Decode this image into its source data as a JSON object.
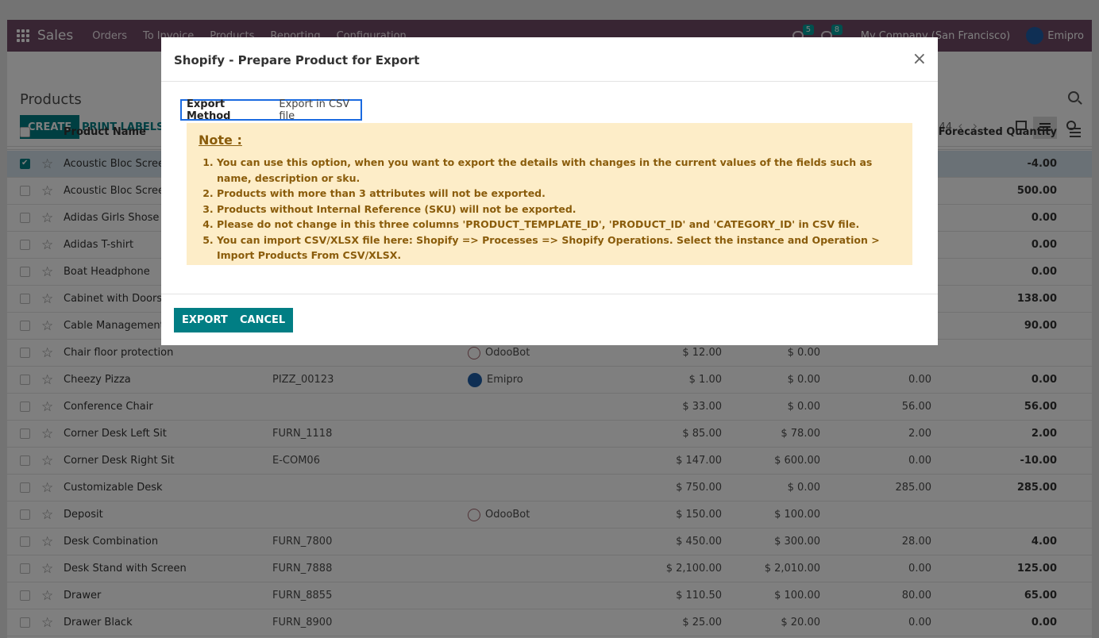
{
  "navbar": {
    "app_name": "Sales",
    "menu": [
      "Orders",
      "To Invoice",
      "Products",
      "Reporting",
      "Configuration"
    ],
    "messages_count": "5",
    "activities_count": "8",
    "company": "My Company (San Francisco)",
    "user": "Emipro"
  },
  "control_panel": {
    "title": "Products",
    "create_label": "CREATE",
    "print_labels_label": "PRINT LABELS",
    "pager_text": "44"
  },
  "table": {
    "col_product_name": "Product Name",
    "col_forecasted": "Forecasted Quantity",
    "rows": [
      {
        "name": "Acoustic Bloc Screens",
        "ref": "",
        "responsible": "",
        "price": "",
        "cost": "",
        "onhand": "",
        "forecast": "-4.00"
      },
      {
        "name": "Acoustic Bloc Screens",
        "ref": "",
        "responsible": "",
        "price": "",
        "cost": "",
        "onhand": "",
        "forecast": "500.00"
      },
      {
        "name": "Adidas Girls Shose",
        "ref": "",
        "responsible": "",
        "price": "",
        "cost": "",
        "onhand": "",
        "forecast": "0.00"
      },
      {
        "name": "Adidas T-shirt",
        "ref": "",
        "responsible": "",
        "price": "",
        "cost": "",
        "onhand": "",
        "forecast": "0.00"
      },
      {
        "name": "Boat Headphone",
        "ref": "",
        "responsible": "",
        "price": "",
        "cost": "",
        "onhand": "",
        "forecast": "0.00"
      },
      {
        "name": "Cabinet with Doors",
        "ref": "",
        "responsible": "",
        "price": "",
        "cost": "",
        "onhand": "",
        "forecast": "138.00"
      },
      {
        "name": "Cable Management Box",
        "ref": "",
        "responsible": "",
        "price": "",
        "cost": "",
        "onhand": "",
        "forecast": "90.00"
      },
      {
        "name": "Chair floor protection",
        "ref": "",
        "responsible": "OdooBot",
        "price": "$ 12.00",
        "cost": "$ 0.00",
        "onhand": "",
        "forecast": ""
      },
      {
        "name": "Cheezy Pizza",
        "ref": "PIZZ_00123",
        "responsible": "Emipro",
        "price": "$ 1.00",
        "cost": "$ 0.00",
        "onhand": "0.00",
        "forecast": "0.00"
      },
      {
        "name": "Conference Chair",
        "ref": "",
        "responsible": "",
        "price": "$ 33.00",
        "cost": "$ 0.00",
        "onhand": "56.00",
        "forecast": "56.00"
      },
      {
        "name": "Corner Desk Left Sit",
        "ref": "FURN_1118",
        "responsible": "",
        "price": "$ 85.00",
        "cost": "$ 78.00",
        "onhand": "2.00",
        "forecast": "2.00"
      },
      {
        "name": "Corner Desk Right Sit",
        "ref": "E-COM06",
        "responsible": "",
        "price": "$ 147.00",
        "cost": "$ 600.00",
        "onhand": "0.00",
        "forecast": "-10.00"
      },
      {
        "name": "Customizable Desk",
        "ref": "",
        "responsible": "",
        "price": "$ 750.00",
        "cost": "$ 0.00",
        "onhand": "285.00",
        "forecast": "285.00"
      },
      {
        "name": "Deposit",
        "ref": "",
        "responsible": "OdooBot",
        "price": "$ 150.00",
        "cost": "$ 100.00",
        "onhand": "",
        "forecast": ""
      },
      {
        "name": "Desk Combination",
        "ref": "FURN_7800",
        "responsible": "",
        "price": "$ 450.00",
        "cost": "$ 300.00",
        "onhand": "28.00",
        "forecast": "4.00"
      },
      {
        "name": "Desk Stand with Screen",
        "ref": "FURN_7888",
        "responsible": "",
        "price": "$ 2,100.00",
        "cost": "$ 2,010.00",
        "onhand": "0.00",
        "forecast": "125.00"
      },
      {
        "name": "Drawer",
        "ref": "FURN_8855",
        "responsible": "",
        "price": "$ 110.50",
        "cost": "$ 100.00",
        "onhand": "80.00",
        "forecast": "65.00"
      },
      {
        "name": "Drawer Black",
        "ref": "FURN_8900",
        "responsible": "",
        "price": "$ 25.00",
        "cost": "$ 20.00",
        "onhand": "0.00",
        "forecast": "0.00"
      }
    ]
  },
  "modal": {
    "title": "Shopify - Prepare Product for Export",
    "export_method_label": "Export Method",
    "export_method_value": "Export in CSV file",
    "note_title": "Note :",
    "notes": [
      "You can use this option, when you want to export the details with changes in the current values of the fields such as name, description or sku.",
      "Products with more than 3 attributes will not be exported.",
      "Products without Internal Reference (SKU) will not be exported.",
      "Please do not change in this three columns 'PRODUCT_TEMPLATE_ID', 'PRODUCT_ID' and 'CATEGORY_ID' in CSV file.",
      "You can import CSV/XLSX file here: Shopify => Processes => Shopify Operations. Select the instance and Operation > Import Products From CSV/XLSX."
    ],
    "export_label": "EXPORT",
    "cancel_label": "CANCEL"
  },
  "colors": {
    "navbar": "#714b67",
    "primary": "#017e84",
    "note_bg": "#fdedc8",
    "note_text": "#8a5c0b",
    "negative": "#d23f3a"
  }
}
